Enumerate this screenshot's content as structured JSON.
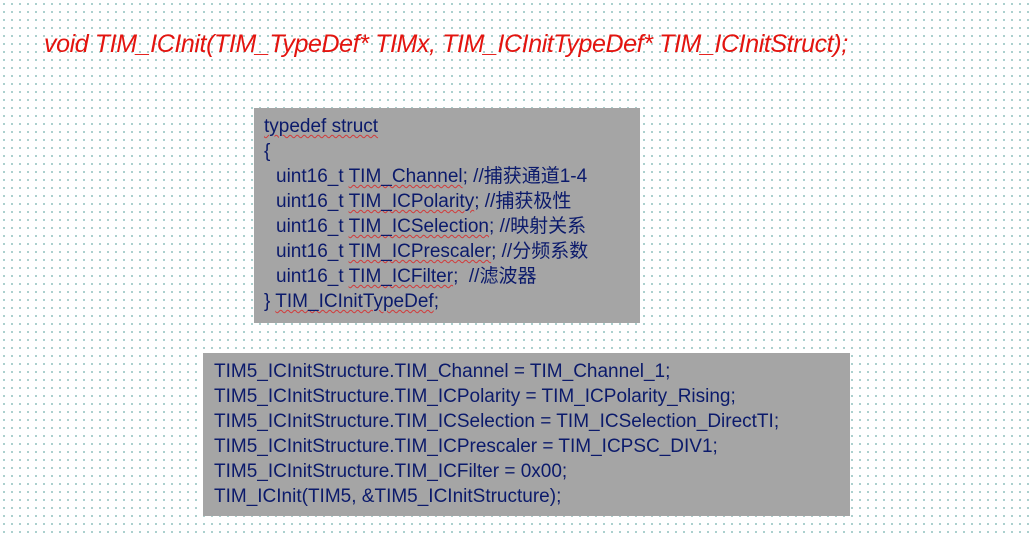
{
  "colors": {
    "signature_text": "#e3140f",
    "box_background": "#a5a5a5",
    "code_text": "#0b1a6b",
    "dot_pattern": "#9ec9c6"
  },
  "signature": "void TIM_ICInit(TIM_TypeDef* TIMx, TIM_ICInitTypeDef* TIM_ICInitStruct);",
  "struct_block": {
    "opening": "typedef struct",
    "open_brace": "{",
    "members": [
      {
        "type": "uint16_t",
        "name": "TIM_Channel",
        "terminator": ";",
        "comment": " //捕获通道1-4"
      },
      {
        "type": "uint16_t",
        "name": "TIM_ICPolarity",
        "terminator": ";",
        "comment": " //捕获极性"
      },
      {
        "type": "uint16_t",
        "name": "TIM_ICSelection",
        "terminator": ";",
        "comment": " //映射关系"
      },
      {
        "type": "uint16_t",
        "name": "TIM_ICPrescaler",
        "terminator": ";",
        "comment": " //分频系数"
      },
      {
        "type": "uint16_t",
        "name": "TIM_ICFilter",
        "terminator": ";",
        "comment": "  //滤波器"
      }
    ],
    "close_brace": "}",
    "typedef_name": "TIM_ICInitTypeDef",
    "closing_semicolon": ";"
  },
  "usage_block": {
    "lines": [
      "TIM5_ICInitStructure.TIM_Channel = TIM_Channel_1;",
      "TIM5_ICInitStructure.TIM_ICPolarity = TIM_ICPolarity_Rising;",
      "TIM5_ICInitStructure.TIM_ICSelection = TIM_ICSelection_DirectTI;",
      "TIM5_ICInitStructure.TIM_ICPrescaler = TIM_ICPSC_DIV1;",
      "TIM5_ICInitStructure.TIM_ICFilter = 0x00;",
      "TIM_ICInit(TIM5, &TIM5_ICInitStructure);"
    ]
  }
}
